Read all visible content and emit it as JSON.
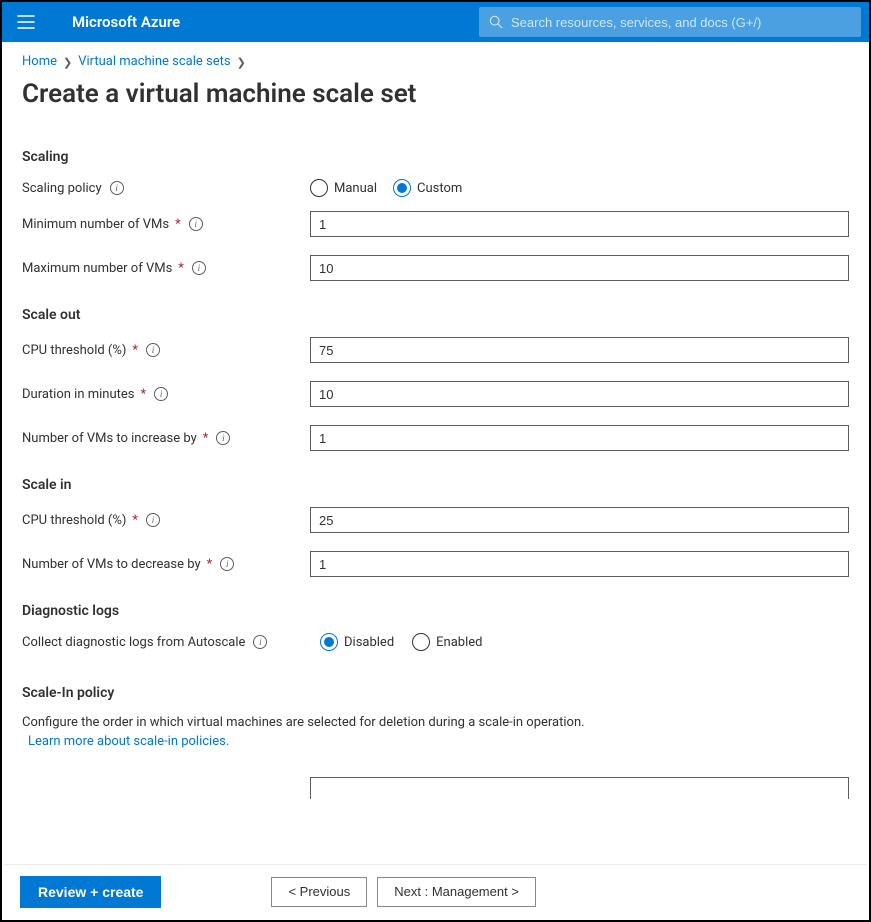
{
  "brand": "Microsoft Azure",
  "search": {
    "placeholder": "Search resources, services, and docs (G+/)"
  },
  "breadcrumb": {
    "home": "Home",
    "vmss": "Virtual machine scale sets"
  },
  "page_title": "Create a virtual machine scale set",
  "scaling": {
    "heading": "Scaling",
    "policy_label": "Scaling policy",
    "policy_options": {
      "manual": "Manual",
      "custom": "Custom"
    },
    "policy_selected": "custom",
    "min_label": "Minimum number of VMs",
    "min_value": "1",
    "max_label": "Maximum number of VMs",
    "max_value": "10"
  },
  "scale_out": {
    "heading": "Scale out",
    "cpu_label": "CPU threshold (%)",
    "cpu_value": "75",
    "duration_label": "Duration in minutes",
    "duration_value": "10",
    "increase_label": "Number of VMs to increase by",
    "increase_value": "1"
  },
  "scale_in": {
    "heading": "Scale in",
    "cpu_label": "CPU threshold (%)",
    "cpu_value": "25",
    "decrease_label": "Number of VMs to decrease by",
    "decrease_value": "1"
  },
  "diag": {
    "heading": "Diagnostic logs",
    "collect_label": "Collect diagnostic logs from Autoscale",
    "options": {
      "disabled": "Disabled",
      "enabled": "Enabled"
    },
    "selected": "disabled"
  },
  "scalein_policy": {
    "heading": "Scale-In policy",
    "desc": "Configure the order in which virtual machines are selected for deletion during a scale-in operation.",
    "link": "Learn more about scale-in policies."
  },
  "footer": {
    "review": "Review + create",
    "prev": "< Previous",
    "next": "Next : Management >"
  }
}
